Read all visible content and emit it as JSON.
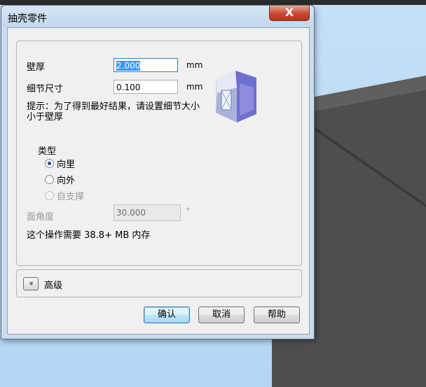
{
  "window": {
    "title": "抽壳零件",
    "close_symbol": "X"
  },
  "form": {
    "thickness_label": "壁厚",
    "thickness_value": "2.000",
    "thickness_unit": "mm",
    "detail_label": "细节尺寸",
    "detail_value": "0.100",
    "detail_unit": "mm",
    "hint": "提示：为了得到最好结果，请设置细节大小小于壁厚",
    "type_label": "类型",
    "options": [
      {
        "label": "向里",
        "checked": true,
        "enabled": true
      },
      {
        "label": "向外",
        "checked": false,
        "enabled": true
      },
      {
        "label": "自支撑",
        "checked": false,
        "enabled": false
      }
    ],
    "face_angle_label": "面角度",
    "face_angle_value": "30.000",
    "face_angle_unit": "°",
    "memory_note": "这个操作需要 38.8+ MB 内存"
  },
  "advanced": {
    "toggle_symbol": "»",
    "label": "高级"
  },
  "buttons": {
    "ok": "确认",
    "cancel": "取消",
    "help": "帮助"
  },
  "icons": {
    "shell_preview": "shell-box-icon",
    "expand": "double-chevron-down-icon"
  },
  "colors": {
    "close_button": "#c94a32",
    "selection": "#3399ff",
    "viewport_sky": "#b9d9f3",
    "viewport_model": "#4e4e4e"
  }
}
